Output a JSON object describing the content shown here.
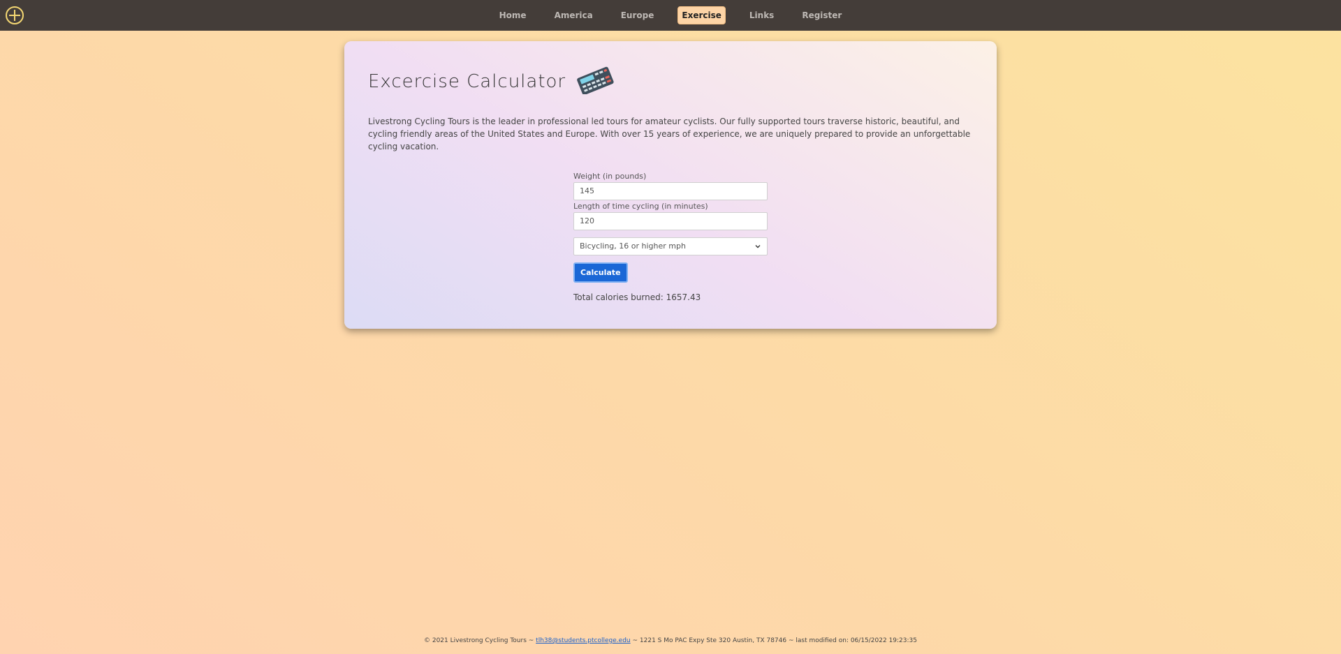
{
  "nav": {
    "items": [
      "Home",
      "America",
      "Europe",
      "Exercise",
      "Links",
      "Register"
    ],
    "active": "Exercise"
  },
  "card": {
    "title": "Excercise Calculator",
    "intro": "Livestrong Cycling Tours is the leader in professional led tours for amateur cyclists. Our fully supported tours traverse historic, beautiful, and cycling friendly areas of the United States and Europe. With over 15 years of experience, we are uniquely prepared to provide an unforgettable cycling vacation."
  },
  "form": {
    "weight_label": "Weight (in pounds)",
    "weight_value": "145",
    "time_label": "Length of time cycling (in minutes)",
    "time_value": "120",
    "activity_selected": "Bicycling, 16 or higher mph",
    "button_label": "Calculate",
    "result": "Total calories burned: 1657.43"
  },
  "footer": {
    "prefix": "© 2021 Livestrong Cycling Tours ~ ",
    "email": "tlh38@students.ptcollege.edu",
    "suffix": " ~ 1221 S Mo PAC Expy Ste 320 Austin, TX 78746 ~ last modified on: 06/15/2022 19:23:35"
  },
  "colors": {
    "topbar": "#443d39",
    "accent": "#f5d873",
    "active_nav": "#fdd4a6",
    "button": "#1a67d6"
  },
  "icons": [
    "plus-circle-icon",
    "calculator-icon",
    "chevron-down-icon"
  ]
}
